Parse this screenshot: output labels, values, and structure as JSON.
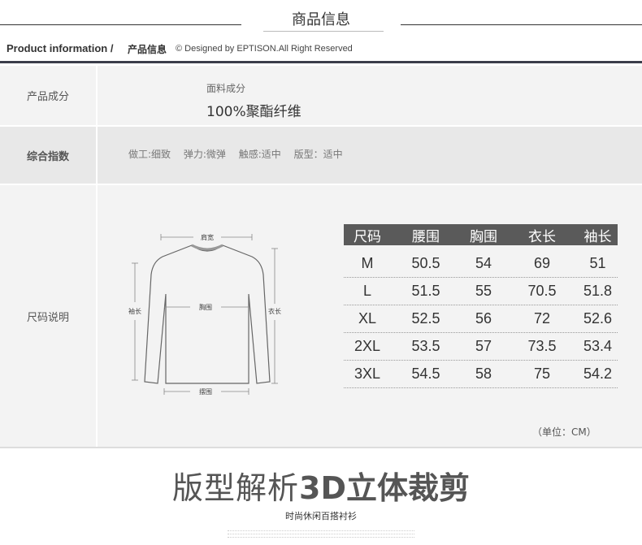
{
  "header": {
    "title": "商品信息",
    "subtitle_en": "Product information /",
    "subtitle_cn": "产品信息",
    "copyright": "© Designed by EPTISON.All Right Reserved"
  },
  "rows": {
    "composition": {
      "label": "产品成分",
      "fabric_label": "面料成分",
      "fabric_value": "100%聚酯纤维"
    },
    "indicators": {
      "label": "综合指数",
      "items": [
        "做工:细致",
        "弹力:微弹",
        "触感:适中",
        "版型：适中"
      ]
    },
    "size": {
      "label": "尺码说明",
      "diagram_labels": {
        "shoulder": "肩宽",
        "chest": "胸围",
        "sleeve": "袖长",
        "length": "衣长",
        "hem": "摆围"
      },
      "unit": "（单位：CM）"
    }
  },
  "size_table": {
    "headers": [
      "尺码",
      "腰围",
      "胸围",
      "衣长",
      "袖长"
    ],
    "rows": [
      [
        "M",
        "50.5",
        "54",
        "69",
        "51"
      ],
      [
        "L",
        "51.5",
        "55",
        "70.5",
        "51.8"
      ],
      [
        "XL",
        "52.5",
        "56",
        "72",
        "52.6"
      ],
      [
        "2XL",
        "53.5",
        "57",
        "73.5",
        "53.4"
      ],
      [
        "3XL",
        "54.5",
        "58",
        "75",
        "54.2"
      ]
    ]
  },
  "banner": {
    "title_light": "版型解析",
    "title_bold": "3D立体裁剪",
    "subtitle": "时尚休闲百搭衬衫"
  }
}
